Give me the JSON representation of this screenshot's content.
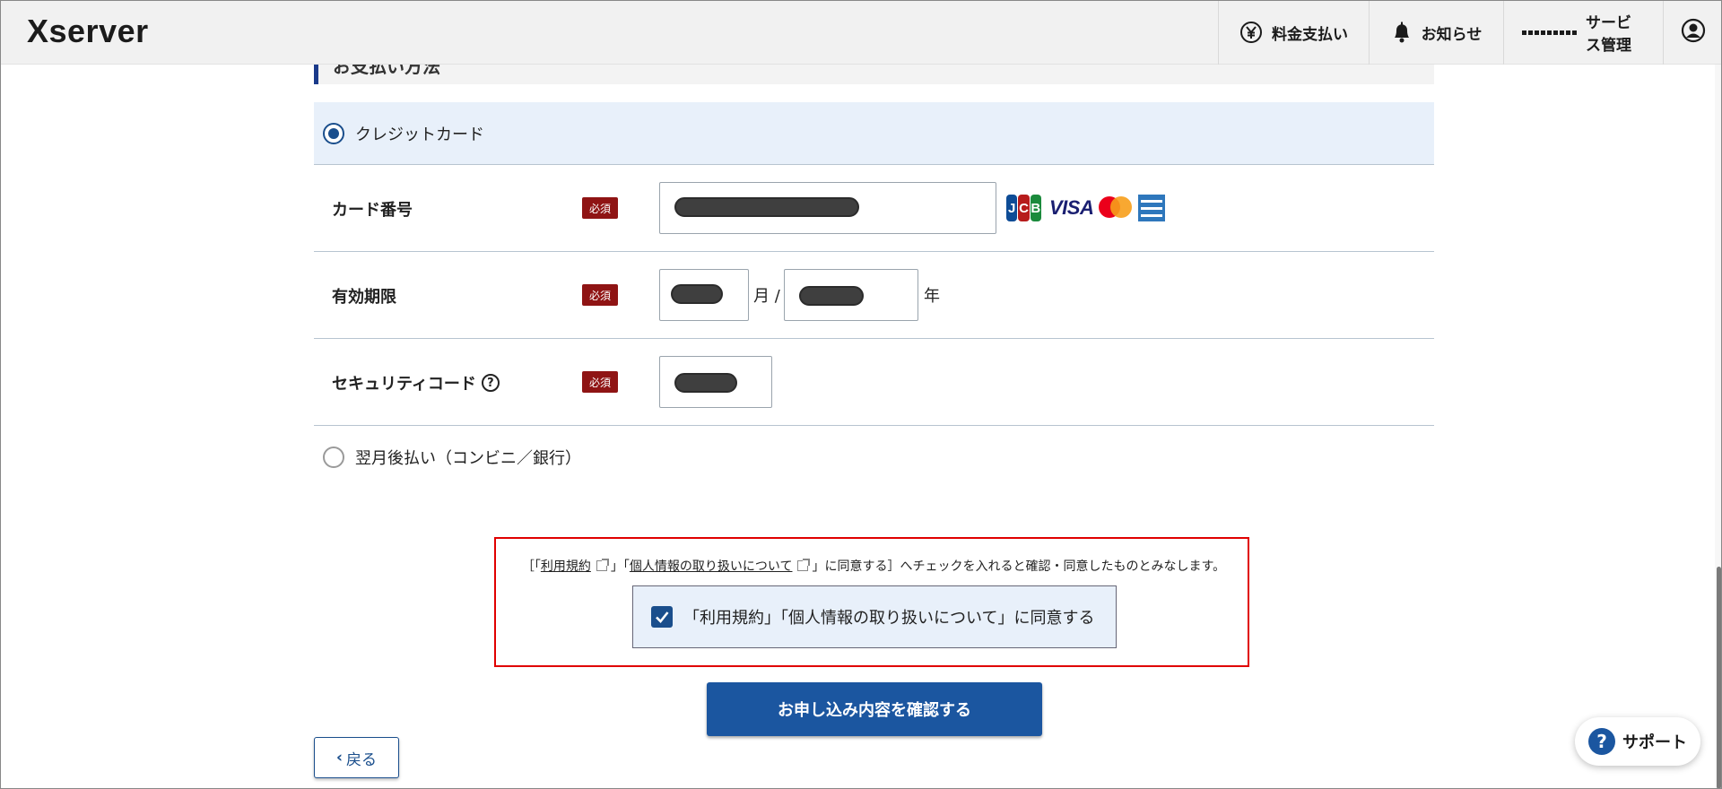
{
  "header": {
    "logo": "Xserver",
    "nav": [
      {
        "label": "料金支払い",
        "icon": "yen-circle-icon"
      },
      {
        "label": "お知らせ",
        "icon": "bell-icon"
      },
      {
        "label": "サービス管理",
        "icon": "grid-icon"
      },
      {
        "label": "",
        "icon": "account-icon"
      }
    ]
  },
  "section": {
    "title": "お支払い方法"
  },
  "payment": {
    "credit_label": "クレジットカード",
    "credit_selected": true,
    "later_label": "翌月後払い（コンビニ／銀行）",
    "later_selected": false
  },
  "form": {
    "card_number_label": "カード番号",
    "expiry_label": "有効期限",
    "security_label": "セキュリティコード",
    "required_badge": "必須",
    "month_unit": "月 /",
    "year_unit": "年",
    "help_mark": "?",
    "card_brands": [
      "JCB",
      "VISA",
      "Mastercard",
      "AMEX"
    ]
  },
  "agreement": {
    "bracket_open": "［「",
    "terms_link": "利用規約",
    "mid": "」「",
    "privacy_link": "個人情報の取り扱いについて",
    "tail": "」に同意する］へチェックを入れると確認・同意したものとみなします。",
    "checkbox_label": "「利用規約」「個人情報の取り扱いについて」に同意する",
    "checked": true
  },
  "buttons": {
    "confirm": "お申し込み内容を確認する",
    "back": "戻る",
    "back_chevron": "‹",
    "support": "サポート",
    "support_mark": "?"
  },
  "colors": {
    "brand_blue": "#1b56a0",
    "required_red": "#8f1414",
    "highlight_border": "#e00000",
    "selected_bg": "#e8f0fa"
  }
}
